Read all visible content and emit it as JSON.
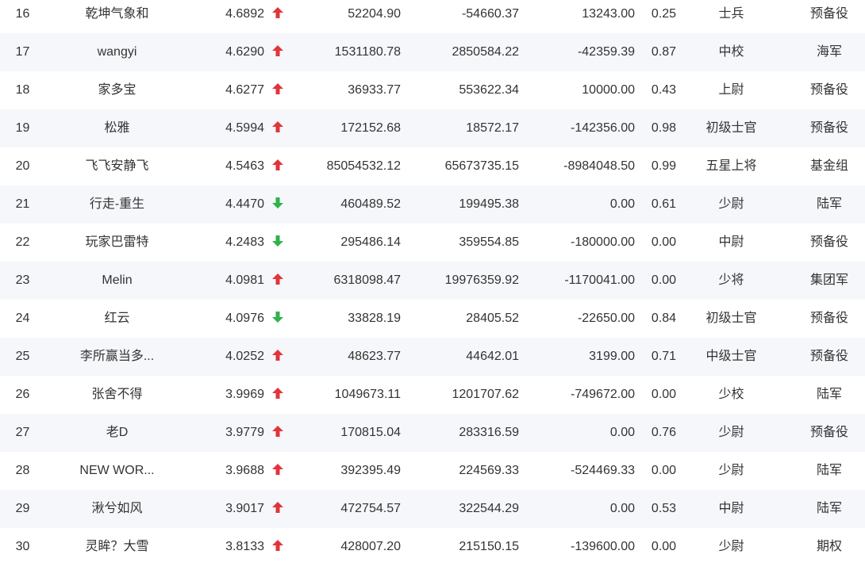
{
  "colors": {
    "up": "#e0353b",
    "down": "#2fb24a",
    "text": "#333333",
    "row_alt": "#f5f7fa"
  },
  "rows": [
    {
      "rank": "16",
      "name": "乾坤气象和",
      "score": "4.6892",
      "trend": "up",
      "v1": "52204.90",
      "v2": "-54660.37",
      "v3": "13243.00",
      "ratio": "0.25",
      "level": "士兵",
      "type": "预备役"
    },
    {
      "rank": "17",
      "name": "wangyi",
      "score": "4.6290",
      "trend": "up",
      "v1": "1531180.78",
      "v2": "2850584.22",
      "v3": "-42359.39",
      "ratio": "0.87",
      "level": "中校",
      "type": "海军"
    },
    {
      "rank": "18",
      "name": "家多宝",
      "score": "4.6277",
      "trend": "up",
      "v1": "36933.77",
      "v2": "553622.34",
      "v3": "10000.00",
      "ratio": "0.43",
      "level": "上尉",
      "type": "预备役"
    },
    {
      "rank": "19",
      "name": "松雅",
      "score": "4.5994",
      "trend": "up",
      "v1": "172152.68",
      "v2": "18572.17",
      "v3": "-142356.00",
      "ratio": "0.98",
      "level": "初级士官",
      "type": "预备役"
    },
    {
      "rank": "20",
      "name": "飞飞安静飞",
      "score": "4.5463",
      "trend": "up",
      "v1": "85054532.12",
      "v2": "65673735.15",
      "v3": "-8984048.50",
      "ratio": "0.99",
      "level": "五星上将",
      "type": "基金组"
    },
    {
      "rank": "21",
      "name": "行走-重生",
      "score": "4.4470",
      "trend": "down",
      "v1": "460489.52",
      "v2": "199495.38",
      "v3": "0.00",
      "ratio": "0.61",
      "level": "少尉",
      "type": "陆军"
    },
    {
      "rank": "22",
      "name": "玩家巴雷特",
      "score": "4.2483",
      "trend": "down",
      "v1": "295486.14",
      "v2": "359554.85",
      "v3": "-180000.00",
      "ratio": "0.00",
      "level": "中尉",
      "type": "预备役"
    },
    {
      "rank": "23",
      "name": "Melin",
      "score": "4.0981",
      "trend": "up",
      "v1": "6318098.47",
      "v2": "19976359.92",
      "v3": "-1170041.00",
      "ratio": "0.00",
      "level": "少将",
      "type": "集团军"
    },
    {
      "rank": "24",
      "name": "红云",
      "score": "4.0976",
      "trend": "down",
      "v1": "33828.19",
      "v2": "28405.52",
      "v3": "-22650.00",
      "ratio": "0.84",
      "level": "初级士官",
      "type": "预备役"
    },
    {
      "rank": "25",
      "name": "李所赢当多...",
      "score": "4.0252",
      "trend": "up",
      "v1": "48623.77",
      "v2": "44642.01",
      "v3": "3199.00",
      "ratio": "0.71",
      "level": "中级士官",
      "type": "预备役"
    },
    {
      "rank": "26",
      "name": "张舍不得",
      "score": "3.9969",
      "trend": "up",
      "v1": "1049673.11",
      "v2": "1201707.62",
      "v3": "-749672.00",
      "ratio": "0.00",
      "level": "少校",
      "type": "陆军"
    },
    {
      "rank": "27",
      "name": "老D",
      "score": "3.9779",
      "trend": "up",
      "v1": "170815.04",
      "v2": "283316.59",
      "v3": "0.00",
      "ratio": "0.76",
      "level": "少尉",
      "type": "预备役"
    },
    {
      "rank": "28",
      "name": "NEW WOR...",
      "score": "3.9688",
      "trend": "up",
      "v1": "392395.49",
      "v2": "224569.33",
      "v3": "-524469.33",
      "ratio": "0.00",
      "level": "少尉",
      "type": "陆军"
    },
    {
      "rank": "29",
      "name": "湫兮如风",
      "score": "3.9017",
      "trend": "up",
      "v1": "472754.57",
      "v2": "322544.29",
      "v3": "0.00",
      "ratio": "0.53",
      "level": "中尉",
      "type": "陆军"
    },
    {
      "rank": "30",
      "name": "灵眸？大雪",
      "score": "3.8133",
      "trend": "up",
      "v1": "428007.20",
      "v2": "215150.15",
      "v3": "-139600.00",
      "ratio": "0.00",
      "level": "少尉",
      "type": "期权"
    }
  ]
}
